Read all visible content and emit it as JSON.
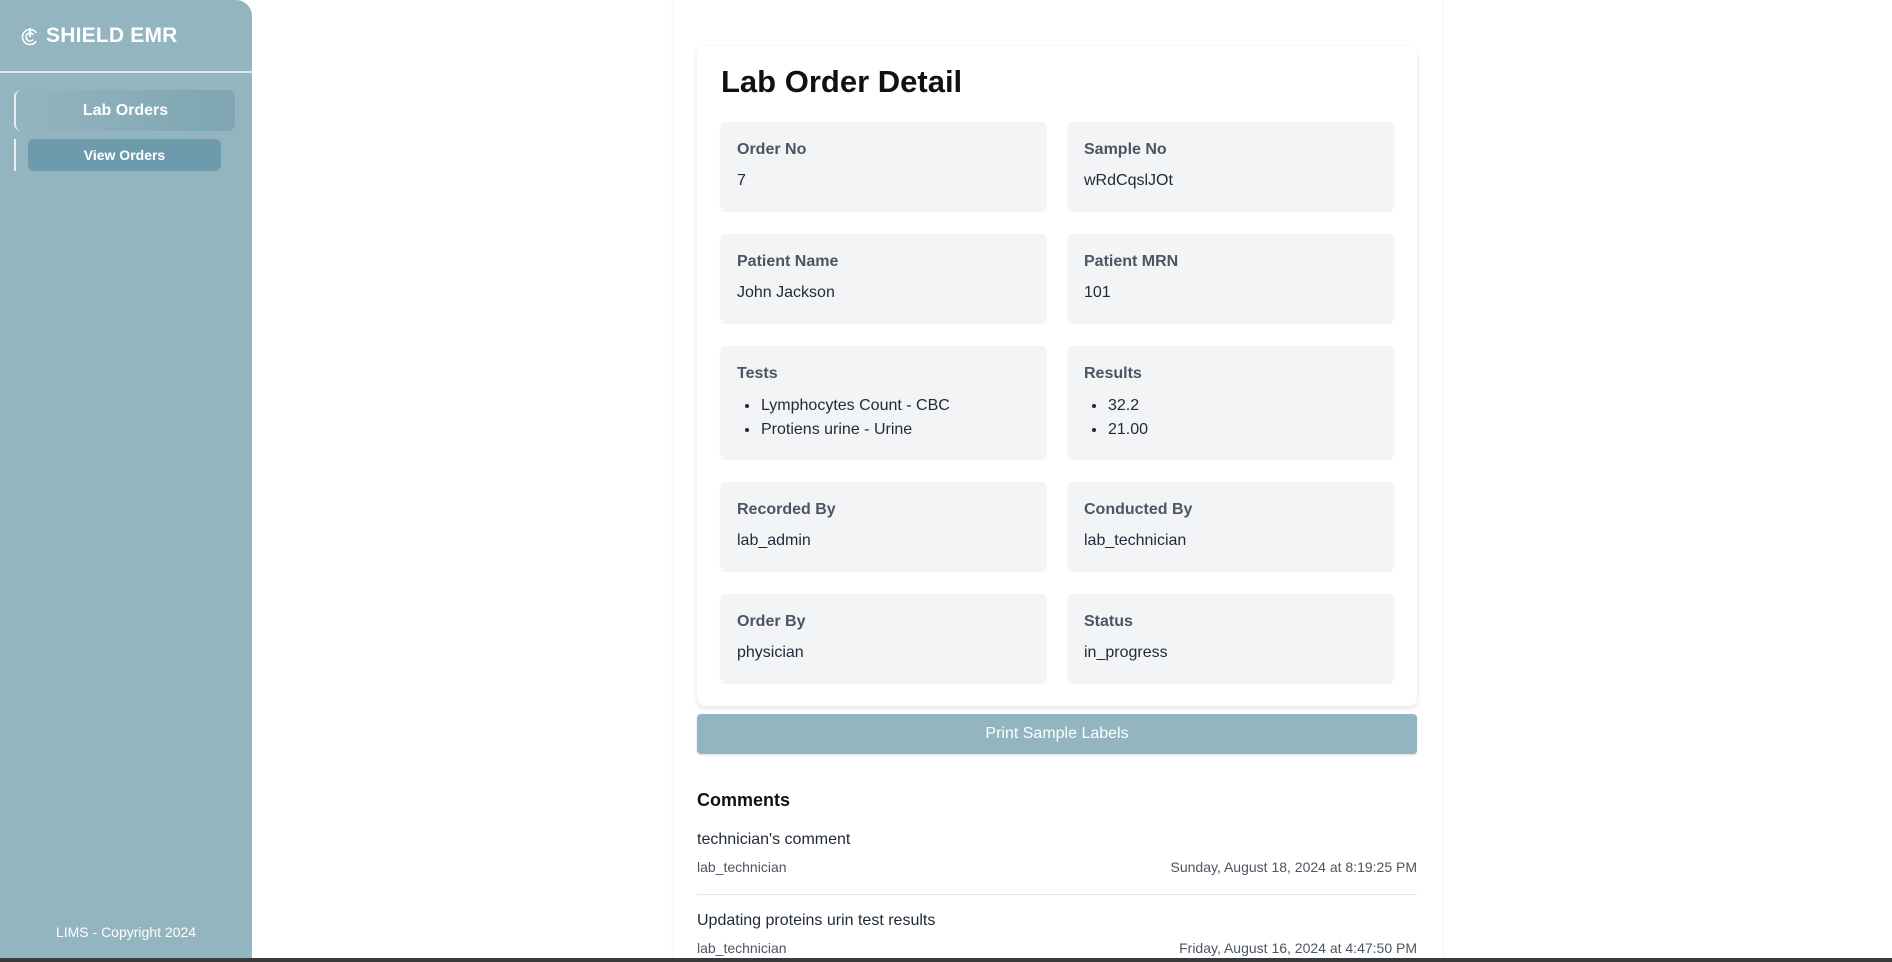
{
  "sidebar": {
    "brand": "SHIELD EMR",
    "brand_icon": "power-shield-icon",
    "nav": {
      "main_label": "Lab Orders",
      "sub_label": "View Orders"
    },
    "footer": "LIMS - Copyright 2024"
  },
  "detail": {
    "title": "Lab Order Detail",
    "order_no": {
      "label": "Order No",
      "value": "7"
    },
    "sample_no": {
      "label": "Sample No",
      "value": "wRdCqslJOt"
    },
    "patient_name": {
      "label": "Patient Name",
      "value": "John Jackson"
    },
    "patient_mrn": {
      "label": "Patient MRN",
      "value": "101"
    },
    "tests": {
      "label": "Tests",
      "items": [
        "Lymphocytes Count - CBC",
        "Protiens urine - Urine"
      ]
    },
    "results": {
      "label": "Results",
      "items": [
        "32.2",
        "21.00"
      ]
    },
    "recorded_by": {
      "label": "Recorded By",
      "value": "lab_admin"
    },
    "conducted_by": {
      "label": "Conducted By",
      "value": "lab_technician"
    },
    "order_by": {
      "label": "Order By",
      "value": "physician"
    },
    "status": {
      "label": "Status",
      "value": "in_progress"
    }
  },
  "print_button": "Print Sample Labels",
  "comments": {
    "title": "Comments",
    "items": [
      {
        "text": "technician's comment",
        "author": "lab_technician",
        "timestamp": "Sunday, August 18, 2024 at 8:19:25 PM"
      },
      {
        "text": "Updating proteins urin test results",
        "author": "lab_technician",
        "timestamp": "Friday, August 16, 2024 at 4:47:50 PM"
      }
    ]
  },
  "colors": {
    "sidebar": "#93b5c0",
    "nav_active": "#6e9bac",
    "button": "#93b5c0",
    "field_bg": "#f2f4f6"
  }
}
